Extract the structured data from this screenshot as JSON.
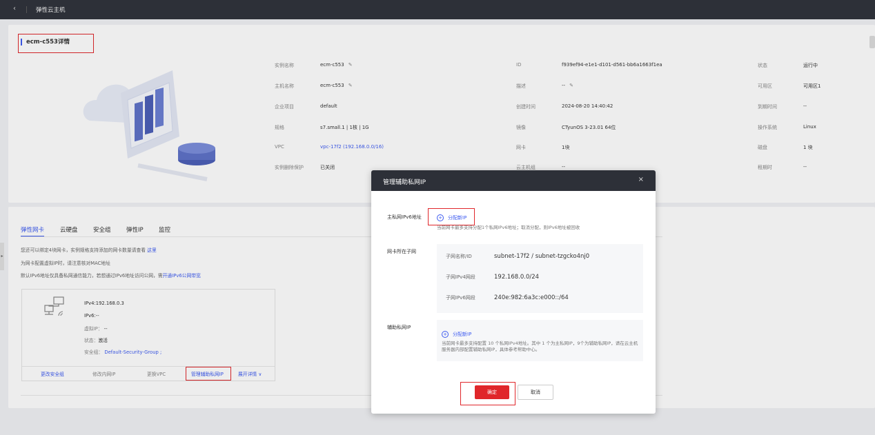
{
  "topbar": {
    "back": "‹",
    "title": "弹性云主机"
  },
  "detail_title": "ecm-c553详情",
  "info": {
    "col1": [
      {
        "label": "实例名称",
        "value": "ecm-c553",
        "editable": true
      },
      {
        "label": "主机名称",
        "value": "ecm-c553",
        "editable": true
      },
      {
        "label": "企业项目",
        "value": "default"
      },
      {
        "label": "规格",
        "value": "s7.small.1 | 1核 | 1G"
      },
      {
        "label": "VPC",
        "value": "vpc-17f2 (192.168.0.0/16)",
        "link": true
      },
      {
        "label": "实例删除保护",
        "value": "已关闭"
      }
    ],
    "col2": [
      {
        "label": "ID",
        "value": "f939ef94-e1e1-d101-d561-bb6a1663f1ea"
      },
      {
        "label": "描述",
        "value": "--",
        "editable": true
      },
      {
        "label": "创建时间",
        "value": "2024-08-20 14:40:42"
      },
      {
        "label": "镜像",
        "value": "CTyunOS 3-23.01 64位"
      },
      {
        "label": "网卡",
        "value": "1块"
      },
      {
        "label": "云主机组",
        "value": "--"
      }
    ],
    "col3": [
      {
        "label": "状态",
        "value": "运行中"
      },
      {
        "label": "可用区",
        "value": "可用区1"
      },
      {
        "label": "到期时间",
        "value": "--"
      },
      {
        "label": "操作系统",
        "value": "Linux"
      },
      {
        "label": "磁盘",
        "value": "1 块"
      },
      {
        "label": "租期时",
        "value": "--"
      }
    ]
  },
  "tabs": [
    "弹性网卡",
    "云硬盘",
    "安全组",
    "弹性IP",
    "监控"
  ],
  "notices": {
    "n1_prefix": "您还可以绑定4块网卡，实例规格支持添加的网卡数量请查看",
    "n1_link": "这里",
    "n2": "为网卡配置虚拟IP时，请注意核对MAC地址",
    "n3_prefix": "默认IPv6地址仅具备私网通信能力，若想通过IPv6地址访问公网，需",
    "n3_link": "开通IPv6公网带宽"
  },
  "nic": {
    "ipv4": "IPv4:192.168.0.3",
    "ipv6": "IPv6:--",
    "vip_k": "虚拟IP：",
    "vip_v": "--",
    "status_k": "状态：",
    "status_v": "激活",
    "sg_k": "安全组：",
    "sg_v": "Default-Security-Group ;"
  },
  "nic_actions": [
    "更改安全组",
    "修改内网IP",
    "更换VPC",
    "管理辅助私网IP",
    "展开详情 ∨"
  ],
  "modal": {
    "title": "管理辅助私网IP",
    "close": "×",
    "ipv6_label": "主私网IPv6地址",
    "assign_new": "分配新IP",
    "ipv6_hint": "当前网卡最多支持分配1个私网IPv6地址；取消分配，则IPv6地址被回收",
    "subnet_label": "网卡所在子网",
    "subnet_rows": [
      {
        "k": "子网名称/ID",
        "v": "subnet-17f2 / subnet-tzgcko4nj0"
      },
      {
        "k": "子网IPv4网段",
        "v": "192.168.0.0/24"
      },
      {
        "k": "子网IPv6网段",
        "v": "240e:982:6a3c:e000::/64"
      }
    ],
    "aux_label": "辅助私网IP",
    "aux_assign": "分配新IP",
    "aux_hint": "当前网卡最多支持配置 10 个私网IPv4地址。其中 1 个为主私网IP，9个为辅助私网IP，请在云主机服务器内部配置辅助私网IP，具体参考帮助中心。",
    "ok": "确定",
    "cancel": "取消"
  },
  "colors": {
    "accent": "#3d5bf0",
    "danger": "#e0262a",
    "header": "#2d3038"
  }
}
